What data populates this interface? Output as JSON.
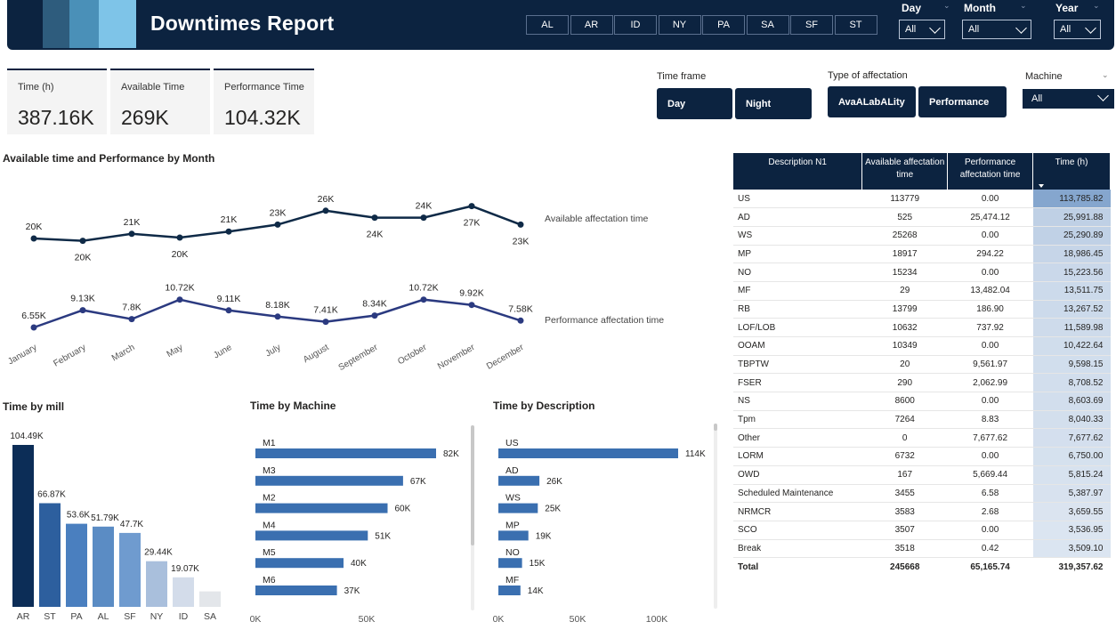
{
  "header": {
    "title": "Downtimes Report",
    "logo_colors": [
      "#2e5c7d",
      "#4a90b8",
      "#7ec4e8"
    ],
    "mill_buttons": [
      "AL",
      "AR",
      "ID",
      "NY",
      "PA",
      "SA",
      "SF",
      "ST"
    ],
    "slicers": [
      {
        "label": "Day",
        "value": "All"
      },
      {
        "label": "Month",
        "value": "All"
      },
      {
        "label": "Year",
        "value": "All"
      }
    ]
  },
  "kpis": [
    {
      "label": "Time (h)",
      "value": "387.16K"
    },
    {
      "label": "Available Time",
      "value": "269K"
    },
    {
      "label": "Performance Time",
      "value": "104.32K"
    }
  ],
  "filters": {
    "time_frame": {
      "title": "Time frame",
      "options": [
        "Day",
        "Night"
      ]
    },
    "affectation": {
      "title": "Type of affectation",
      "options": [
        "AvaALabALity",
        "Performance"
      ]
    },
    "machine": {
      "title": "Machine",
      "value": "All"
    }
  },
  "colors": {
    "navy": "#0c2340",
    "line_available": "#0f2a47",
    "line_performance": "#2b3a80",
    "bar_blue": "#3a6fb0"
  },
  "line_chart": {
    "title": "Available time and Performance by Month",
    "chart_data": {
      "type": "line",
      "x": [
        "January",
        "February",
        "March",
        "May",
        "June",
        "July",
        "August",
        "September",
        "October",
        "November",
        "December"
      ],
      "series": [
        {
          "name": "Available affectation time",
          "values": [
            20,
            19.5,
            21,
            20.2,
            21.5,
            23,
            26,
            24.5,
            24.5,
            27,
            23
          ],
          "labels": [
            "20K",
            "20K",
            "21K",
            "20K",
            "21K",
            "23K",
            "26K",
            "24K",
            "24K",
            "27K",
            "23K"
          ]
        },
        {
          "name": "Performance affectation time",
          "values": [
            6.55,
            9.13,
            7.8,
            10.72,
            9.11,
            8.18,
            7.41,
            8.34,
            10.72,
            9.92,
            7.58
          ],
          "labels": [
            "6.55K",
            "9.13K",
            "7.8K",
            "10.72K",
            "9.11K",
            "8.18K",
            "7.41K",
            "8.34K",
            "10.72K",
            "9.92K",
            "7.58K"
          ]
        }
      ]
    }
  },
  "mill_chart": {
    "title": "Time by mill",
    "chart_data": {
      "type": "bar",
      "categories": [
        "AR",
        "ST",
        "PA",
        "AL",
        "SF",
        "NY",
        "ID",
        "SA"
      ],
      "values": [
        104.49,
        66.87,
        53.6,
        51.79,
        47.7,
        29.44,
        19.07,
        10
      ],
      "labels": [
        "104.49K",
        "66.87K",
        "53.6K",
        "51.79K",
        "47.7K",
        "29.44K",
        "19.07K",
        ""
      ],
      "colors": [
        "#0c2d57",
        "#2d5f9e",
        "#4a7fbf",
        "#5b8cc4",
        "#6f9bcf",
        "#a9bfdc",
        "#d3dcea",
        "#e3e6ea"
      ]
    }
  },
  "machine_chart": {
    "title": "Time by Machine",
    "chart_data": {
      "type": "bar",
      "categories": [
        "M1",
        "M3",
        "M2",
        "M4",
        "M5",
        "M6"
      ],
      "values": [
        82,
        67,
        60,
        51,
        40,
        37
      ],
      "labels": [
        "82K",
        "67K",
        "60K",
        "51K",
        "40K",
        "37K"
      ],
      "axis_ticks": [
        "0K",
        "50K"
      ]
    }
  },
  "description_chart": {
    "title": "Time by Description",
    "chart_data": {
      "type": "bar",
      "categories": [
        "US",
        "AD",
        "WS",
        "MP",
        "NO",
        "MF"
      ],
      "values": [
        114,
        26,
        25,
        19,
        15,
        14
      ],
      "labels": [
        "114K",
        "26K",
        "25K",
        "19K",
        "15K",
        "14K"
      ],
      "axis_ticks": [
        "0K",
        "50K",
        "100K"
      ]
    }
  },
  "table": {
    "headers": [
      "Description N1",
      "Available affectation time",
      "Performance affectation time",
      "Time (h)"
    ],
    "rows": [
      [
        "US",
        "113779",
        "0.00",
        "113,785.82"
      ],
      [
        "AD",
        "525",
        "25,474.12",
        "25,991.88"
      ],
      [
        "WS",
        "25268",
        "0.00",
        "25,290.89"
      ],
      [
        "MP",
        "18917",
        "294.22",
        "18,986.45"
      ],
      [
        "NO",
        "15234",
        "0.00",
        "15,223.56"
      ],
      [
        "MF",
        "29",
        "13,482.04",
        "13,511.75"
      ],
      [
        "RB",
        "13799",
        "186.90",
        "13,267.52"
      ],
      [
        "LOF/LOB",
        "10632",
        "737.92",
        "11,589.98"
      ],
      [
        "OOAM",
        "10349",
        "0.00",
        "10,422.64"
      ],
      [
        "TBPTW",
        "20",
        "9,561.97",
        "9,598.15"
      ],
      [
        "FSER",
        "290",
        "2,062.99",
        "8,708.52"
      ],
      [
        "NS",
        "8600",
        "0.00",
        "8,603.69"
      ],
      [
        "Tpm",
        "7264",
        "8.83",
        "8,040.33"
      ],
      [
        "Other",
        "0",
        "7,677.62",
        "7,677.62"
      ],
      [
        "LORM",
        "6732",
        "0.00",
        "6,750.00"
      ],
      [
        "OWD",
        "167",
        "5,669.44",
        "5,815.24"
      ],
      [
        "Scheduled Maintenance",
        "3455",
        "6.58",
        "5,387.97"
      ],
      [
        "NRMCR",
        "3583",
        "2.68",
        "3,659.55"
      ],
      [
        "SCO",
        "3507",
        "0.00",
        "3,536.95"
      ],
      [
        "Break",
        "3518",
        "0.42",
        "3,509.10"
      ]
    ],
    "total": [
      "Total",
      "245668",
      "65,165.74",
      "319,357.62"
    ],
    "time_values": [
      113785.82,
      25991.88,
      25290.89,
      18986.45,
      15223.56,
      13511.75,
      13267.52,
      11589.98,
      10422.64,
      9598.15,
      8708.52,
      8603.69,
      8040.33,
      7677.62,
      6750.0,
      5815.24,
      5387.97,
      3659.55,
      3536.95,
      3509.1
    ]
  }
}
